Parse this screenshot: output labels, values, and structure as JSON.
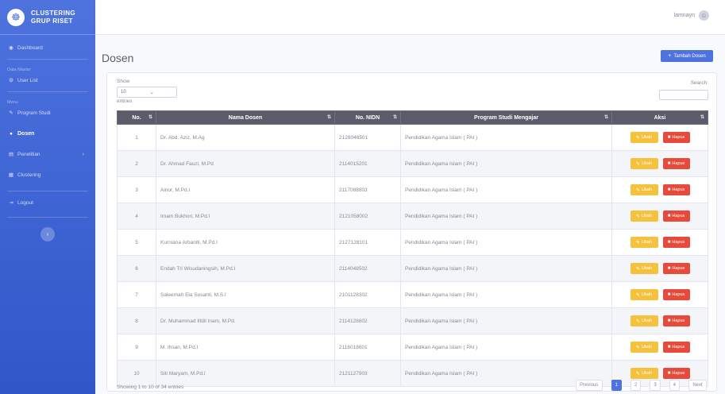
{
  "brand": {
    "line1": "CLUSTERING",
    "line2": "GRUP RISET"
  },
  "sidebar": {
    "dashboard": "Dashboard",
    "heading_master": "Data Master",
    "user_list": "User List",
    "heading_menu": "Menu",
    "program_studi": "Program Studi",
    "dosen": "Dosen",
    "penelitian": "Penelitian",
    "clustering": "Clustering",
    "logout": "Logout"
  },
  "topbar": {
    "username": "lamnayn"
  },
  "page": {
    "title": "Dosen",
    "add_button": "Tambah Dosen"
  },
  "controls": {
    "show_label": "Show",
    "show_value": "10",
    "entries_label": "entries",
    "search_label": "Search:",
    "search_value": ""
  },
  "table": {
    "headers": {
      "no": "No.",
      "nama": "Nama Dosen",
      "nidn": "No. NIDN",
      "prodi": "Program Studi Mengajar",
      "aksi": "Aksi"
    },
    "edit_label": "Ubah",
    "delete_label": "Hapus",
    "rows": [
      {
        "no": "1",
        "nama": "Dr. Abd. Aziz, M.Ag",
        "nidn": "2128046501",
        "prodi": "Pendidikan Agama Islam ( PAI )"
      },
      {
        "no": "2",
        "nama": "Dr. Ahmad Fauzi, M.Pd",
        "nidn": "2114015201",
        "prodi": "Pendidikan Agama Islam ( PAI )"
      },
      {
        "no": "3",
        "nama": "Ainor, M.Pd.I",
        "nidn": "2117088803",
        "prodi": "Pendidikan Agama Islam ( PAI )"
      },
      {
        "no": "4",
        "nama": "Imam Bukhori, M.Pd.I",
        "nidn": "2121058002",
        "prodi": "Pendidikan Agama Islam ( PAI )"
      },
      {
        "no": "5",
        "nama": "Kurniana Arbaniti, M.Pd.I",
        "nidn": "2127128101",
        "prodi": "Pendidikan Agama Islam ( PAI )"
      },
      {
        "no": "6",
        "nama": "Endah Tri Wisudaningsih, M.Pd.I",
        "nidn": "2114048502",
        "prodi": "Pendidikan Agama Islam ( PAI )"
      },
      {
        "no": "7",
        "nama": "Saleemah Ela Susanti, M.S.I",
        "nidn": "2101128302",
        "prodi": "Pendidikan Agama Islam ( PAI )"
      },
      {
        "no": "8",
        "nama": "Dr. Muhammad Ilfdil Inam, M.Pd.",
        "nidn": "2114128802",
        "prodi": "Pendidikan Agama Islam ( PAI )"
      },
      {
        "no": "9",
        "nama": "M. Ihsan, M.Pd.I",
        "nidn": "2116018601",
        "prodi": "Pendidikan Agama Islam ( PAI )"
      },
      {
        "no": "10",
        "nama": "Siti Maryam, M.Pd.I",
        "nidn": "2121127903",
        "prodi": "Pendidikan Agama Islam ( PAI )"
      }
    ]
  },
  "footer": {
    "info": "Showing 1 to 10 of 34 entries",
    "previous": "Previous",
    "pages": [
      "1",
      "2",
      "3",
      "4"
    ],
    "next": "Next"
  },
  "colors": {
    "primary": "#4e73df",
    "warning": "#f6c23e",
    "danger": "#e74a3b",
    "header_dark": "#5a5c69"
  },
  "icons": {
    "brand": "brain-logo-icon",
    "dashboard": "tachometer-icon",
    "user_list": "users-icon",
    "program_studi": "graduation-cap-icon",
    "dosen": "user-tie-icon",
    "penelitian": "book-icon",
    "clustering": "chart-icon",
    "logout": "logout-icon",
    "add": "user-plus-icon",
    "edit": "edit-icon",
    "delete": "trash-icon"
  }
}
